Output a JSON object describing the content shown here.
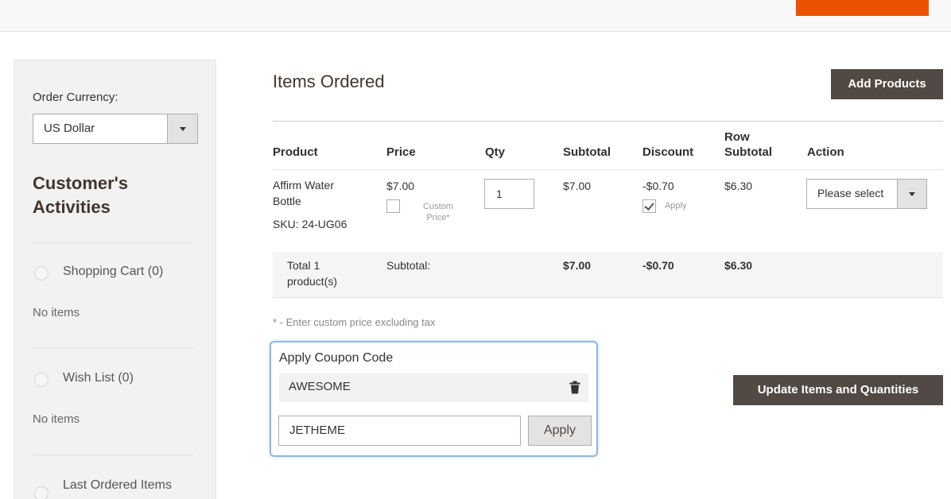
{
  "sidebar": {
    "currency_label": "Order Currency:",
    "currency_value": "US Dollar",
    "activities_title": "Customer's Activities",
    "items": [
      {
        "label": "Shopping Cart (0)",
        "empty": "No items"
      },
      {
        "label": "Wish List (0)",
        "empty": "No items"
      },
      {
        "label": "Last Ordered Items"
      }
    ]
  },
  "main": {
    "title": "Items Ordered",
    "add_products_label": "Add Products",
    "update_label": "Update Items and Quantities",
    "columns": [
      "Product",
      "Price",
      "Qty",
      "Subtotal",
      "Discount",
      "Row Subtotal",
      "Action"
    ],
    "row": {
      "product_name": "Affirm Water Bottle",
      "sku": "SKU: 24-UG06",
      "price": "$7.00",
      "custom_price_label": "Custom Price*",
      "qty": "1",
      "subtotal": "$7.00",
      "discount": "-$0.70",
      "discount_apply_label": "Apply",
      "row_subtotal": "$6.30",
      "action_value": "Please select"
    },
    "totals": {
      "label": "Total 1 product(s)",
      "subtotal_label": "Subtotal:",
      "subtotal": "$7.00",
      "discount": "-$0.70",
      "row_subtotal": "$6.30"
    },
    "custom_note": "* - Enter custom price excluding tax"
  },
  "coupon": {
    "title": "Apply Coupon Code",
    "applied_code": "AWESOME",
    "input_value": "JETHEME",
    "apply_label": "Apply"
  },
  "colors": {
    "accent_orange": "#eb5202",
    "button_dark": "#514943",
    "focus_blue": "#8fb8de"
  }
}
